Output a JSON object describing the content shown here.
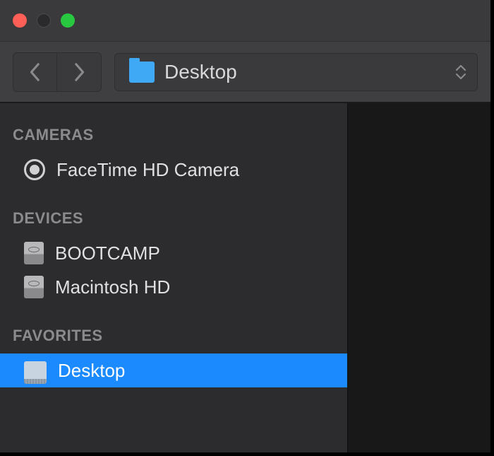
{
  "toolbar": {
    "location_label": "Desktop"
  },
  "sidebar": {
    "sections": {
      "cameras": {
        "title": "CAMERAS",
        "items": [
          {
            "label": "FaceTime HD Camera"
          }
        ]
      },
      "devices": {
        "title": "DEVICES",
        "items": [
          {
            "label": "BOOTCAMP"
          },
          {
            "label": "Macintosh HD"
          }
        ]
      },
      "favorites": {
        "title": "FAVORITES",
        "items": [
          {
            "label": "Desktop",
            "selected": true
          }
        ]
      }
    }
  }
}
